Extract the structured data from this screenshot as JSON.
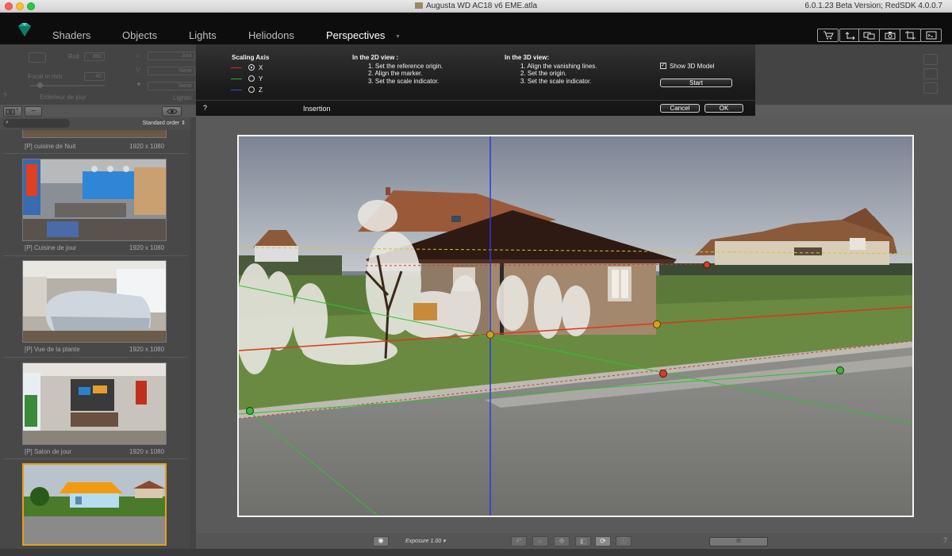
{
  "window": {
    "title": "Augusta WD AC18 v6 EME.atla",
    "version": "6.0.1.23 Beta Version; RedSDK 4.0.0.7"
  },
  "menu": {
    "items": [
      "Shaders",
      "Objects",
      "Lights",
      "Heliodons",
      "Perspectives"
    ],
    "active": "Perspectives",
    "toolbar_icons": [
      "cart-icon",
      "export-icon",
      "screens-icon",
      "camera-icon",
      "crop-icon",
      "console-icon"
    ]
  },
  "left_panel": {
    "roll_label": "Roll",
    "roll_value": "360",
    "focal_label": "Focal in mm",
    "focal_value": "40",
    "exterior_label": "Extérieur de jour",
    "sun_value": "Jour",
    "filter_value": "None",
    "brush_value": "None",
    "lighting_label": "Lightin",
    "help_label": "?"
  },
  "dialog": {
    "scaling_axis_label": "Scaling Axis",
    "axes": [
      {
        "label": "X",
        "color": "#d03020",
        "selected": true
      },
      {
        "label": "Y",
        "color": "#30b030",
        "selected": false
      },
      {
        "label": "Z",
        "color": "#3050d0",
        "selected": false
      }
    ],
    "view2d_title": "In the 2D view :",
    "view2d_steps": [
      "1. Set the reference origin.",
      "2. Align the marker.",
      "3. Set the scale indicator."
    ],
    "view3d_title": "In the 3D view:",
    "view3d_steps": [
      "1. Align the vanishing lines.",
      "2. Set the origin.",
      "3. Set the scale indicator."
    ],
    "show_3d_label": "Show 3D Model",
    "show_3d_checked": true,
    "start_label": "Start",
    "help_label": "?",
    "insertion_label": "Insertion",
    "cancel_label": "Cancel",
    "ok_label": "OK"
  },
  "gallery": {
    "add_icon_label": "+",
    "remove_label": "−",
    "search_placeholder": "",
    "sort_label": "Standard order",
    "items": [
      {
        "name": "[P] cuisine de Nuit",
        "resolution": "1920 x 1080"
      },
      {
        "name": "[P] Cuisine de jour",
        "resolution": "1920 x 1080"
      },
      {
        "name": "[P] Vue de la plante",
        "resolution": "1920 x 1080"
      },
      {
        "name": "[P] Salon de jour",
        "resolution": "1920 x 1080"
      },
      {
        "name": "",
        "resolution": ""
      }
    ]
  },
  "bottom_bar": {
    "exposure_label": "Exposure 1.00",
    "help_label": "?",
    "slider_label": "III"
  }
}
